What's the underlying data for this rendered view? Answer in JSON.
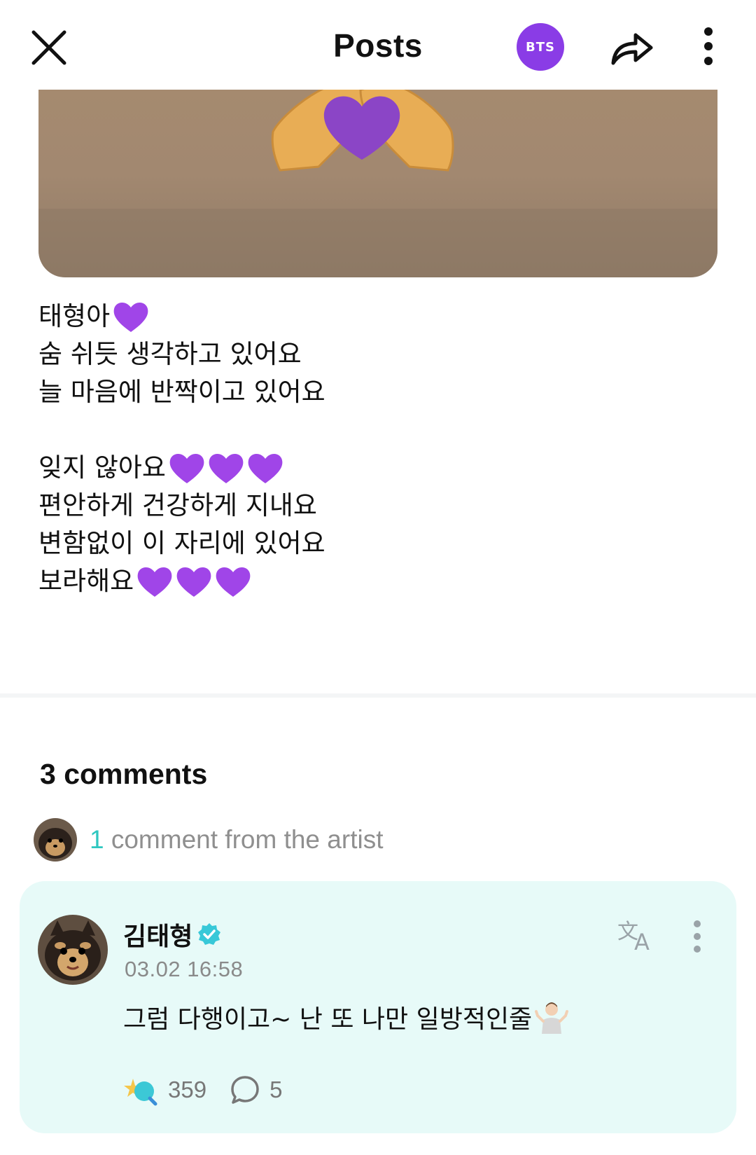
{
  "header": {
    "title": "Posts",
    "community_badge": "BTS",
    "icons": [
      "close-icon",
      "share-icon",
      "more-vertical-icon"
    ],
    "accent_color": "#8a3ce6"
  },
  "post": {
    "image": {
      "description_icon": "heart-hands-icon"
    },
    "lines": [
      "태형아",
      "숨 쉬듯 생각하고 있어요",
      "늘 마음에 반짝이고 있어요",
      "",
      "잊지 않아요",
      "편안하게 건강하게 지내요",
      "변함없이 이 자리에 있어요",
      "보라해요"
    ]
  },
  "comments": {
    "count_label": "3 comments",
    "artist_summary": {
      "count": "1",
      "text": "comment from the artist"
    },
    "items": [
      {
        "author": "김태형",
        "verified": true,
        "timestamp": "03.02 16:58",
        "text": "그럼 다행이고~ 난 또 나만 일방적인줄",
        "likes": "359",
        "replies": "5",
        "highlight_color": "#e7faf8"
      }
    ]
  }
}
